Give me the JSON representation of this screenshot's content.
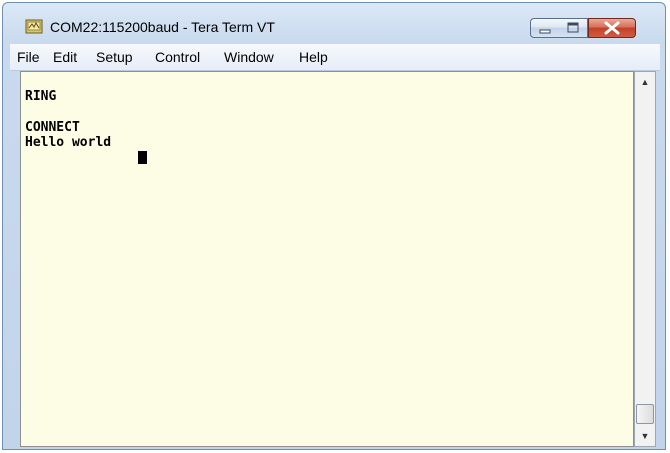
{
  "window": {
    "title": "COM22:115200baud - Tera Term VT",
    "app_icon": "tera-term-icon",
    "controls": {
      "minimize_icon": "minimize-icon",
      "maximize_icon": "maximize-icon",
      "close_icon": "close-icon",
      "close_color": "#c8442c"
    }
  },
  "menu": {
    "items": [
      {
        "label": "File"
      },
      {
        "label": "Edit"
      },
      {
        "label": "Setup"
      },
      {
        "label": "Control"
      },
      {
        "label": "Window"
      },
      {
        "label": "Help"
      }
    ]
  },
  "terminal": {
    "lines": [
      "RING",
      "",
      "CONNECT",
      "Hello world"
    ],
    "background": "#fdfde6",
    "text_color": "#000000"
  },
  "scrollbar": {
    "up_icon": "scroll-up-arrow-icon",
    "down_icon": "scroll-down-arrow-icon"
  }
}
